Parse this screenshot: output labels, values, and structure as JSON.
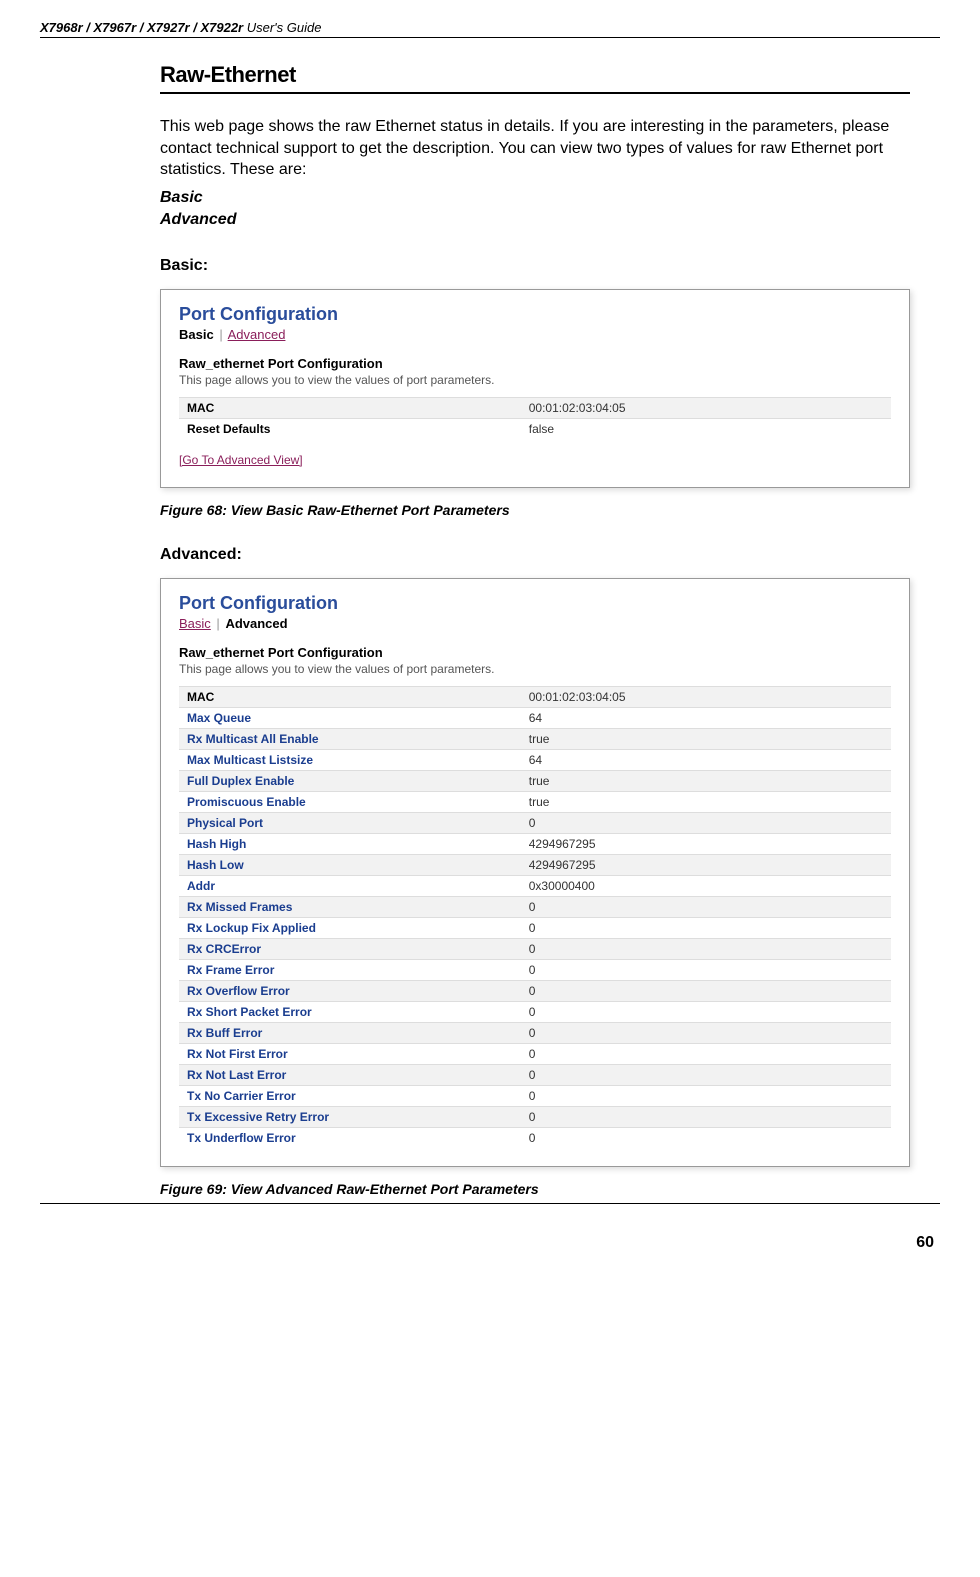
{
  "header": {
    "models": "X7968r / X7967r / X7927r / X7922r",
    "guide": " User's Guide"
  },
  "section_title": "Raw-Ethernet",
  "intro": "This web page shows the raw Ethernet status in details. If you are interesting in the parameters, please contact technical support to get the description. You can view two types of values for raw Ethernet port statistics. These are:",
  "type_basic": "Basic",
  "type_advanced": "Advanced",
  "basic_heading": "Basic:",
  "advanced_heading": "Advanced:",
  "figure68": "Figure 68: View Basic Raw-Ethernet Port Parameters",
  "figure69": "Figure 69: View Advanced    Raw-Ethernet Port Parameters",
  "page_number": "60",
  "screenshot_common": {
    "title": "Port Configuration",
    "tab_basic": "Basic",
    "tab_advanced": "Advanced",
    "sub_title": "Raw_ethernet Port Configuration",
    "desc": "This page allows you to view the values of port parameters.",
    "goto_advanced": "[Go To Advanced View]"
  },
  "basic_rows": [
    {
      "label": "MAC",
      "value": "00:01:02:03:04:05"
    },
    {
      "label": "Reset Defaults",
      "value": "false"
    }
  ],
  "advanced_rows": [
    {
      "label": "MAC",
      "value": "00:01:02:03:04:05"
    },
    {
      "label": "Max Queue",
      "value": "64"
    },
    {
      "label": "Rx Multicast All Enable",
      "value": "true"
    },
    {
      "label": "Max Multicast Listsize",
      "value": "64"
    },
    {
      "label": "Full Duplex Enable",
      "value": "true"
    },
    {
      "label": "Promiscuous Enable",
      "value": "true"
    },
    {
      "label": "Physical Port",
      "value": "0"
    },
    {
      "label": "Hash High",
      "value": "4294967295"
    },
    {
      "label": "Hash Low",
      "value": "4294967295"
    },
    {
      "label": "Addr",
      "value": "0x30000400"
    },
    {
      "label": "Rx Missed Frames",
      "value": "0"
    },
    {
      "label": "Rx Lockup Fix Applied",
      "value": "0"
    },
    {
      "label": "Rx CRCError",
      "value": "0"
    },
    {
      "label": "Rx Frame Error",
      "value": "0"
    },
    {
      "label": "Rx Overflow Error",
      "value": "0"
    },
    {
      "label": "Rx Short Packet Error",
      "value": "0"
    },
    {
      "label": "Rx Buff Error",
      "value": "0"
    },
    {
      "label": "Rx Not First Error",
      "value": "0"
    },
    {
      "label": "Rx Not Last Error",
      "value": "0"
    },
    {
      "label": "Tx No Carrier Error",
      "value": "0"
    },
    {
      "label": "Tx Excessive Retry Error",
      "value": "0"
    },
    {
      "label": "Tx Underflow Error",
      "value": "0"
    }
  ]
}
